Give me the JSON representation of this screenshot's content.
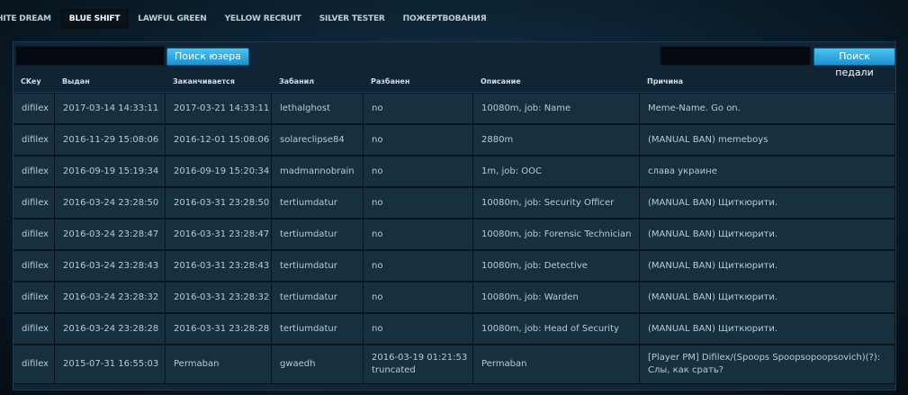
{
  "tabs": [
    {
      "label": "HITE DREAM",
      "active": false
    },
    {
      "label": "BLUE SHIFT",
      "active": true
    },
    {
      "label": "LAWFUL GREEN",
      "active": false
    },
    {
      "label": "YELLOW RECRUIT",
      "active": false
    },
    {
      "label": "SILVER TESTER",
      "active": false
    },
    {
      "label": "ПОЖЕРТВОВАНИЯ",
      "active": false
    }
  ],
  "search": {
    "user_button": "Поиск юзера",
    "admin_button": "Поиск педали",
    "user_value": "",
    "admin_value": ""
  },
  "table": {
    "headers": [
      "CKey",
      "Выдан",
      "Заканчивается",
      "Забанил",
      "Разбанен",
      "Описание",
      "Причина"
    ],
    "rows": [
      [
        "difilex",
        "2017-03-14 14:33:11",
        "2017-03-21 14:33:11",
        "lethalghost",
        "no",
        "10080m, job: Name",
        "Meme-Name. Go on."
      ],
      [
        "difilex",
        "2016-11-29 15:08:06",
        "2016-12-01 15:08:06",
        "solareclipse84",
        "no",
        "2880m",
        "(MANUAL BAN) memeboys"
      ],
      [
        "difilex",
        "2016-09-19 15:19:34",
        "2016-09-19 15:20:34",
        "madmannobrain",
        "no",
        "1m, job: OOC",
        "слава украине"
      ],
      [
        "difilex",
        "2016-03-24 23:28:50",
        "2016-03-31 23:28:50",
        "tertiumdatur",
        "no",
        "10080m, job: Security Officer",
        "(MANUAL BAN) Щиткюрити."
      ],
      [
        "difilex",
        "2016-03-24 23:28:47",
        "2016-03-31 23:28:47",
        "tertiumdatur",
        "no",
        "10080m, job: Forensic Technician",
        "(MANUAL BAN) Щиткюрити."
      ],
      [
        "difilex",
        "2016-03-24 23:28:43",
        "2016-03-31 23:28:43",
        "tertiumdatur",
        "no",
        "10080m, job: Detective",
        "(MANUAL BAN) Щиткюрити."
      ],
      [
        "difilex",
        "2016-03-24 23:28:32",
        "2016-03-31 23:28:32",
        "tertiumdatur",
        "no",
        "10080m, job: Warden",
        "(MANUAL BAN) Щиткюрити."
      ],
      [
        "difilex",
        "2016-03-24 23:28:28",
        "2016-03-31 23:28:28",
        "tertiumdatur",
        "no",
        "10080m, job: Head of Security",
        "(MANUAL BAN) Щиткюрити."
      ],
      [
        "difilex",
        "2015-07-31 16:55:03",
        "Permaban",
        "gwaedh",
        "2016-03-19 01:21:53 truncated",
        "Permaban",
        "[Player PM] Difilex/(Spoops Spoopsopoopsovich)(?): Слы, как срать?"
      ]
    ]
  }
}
